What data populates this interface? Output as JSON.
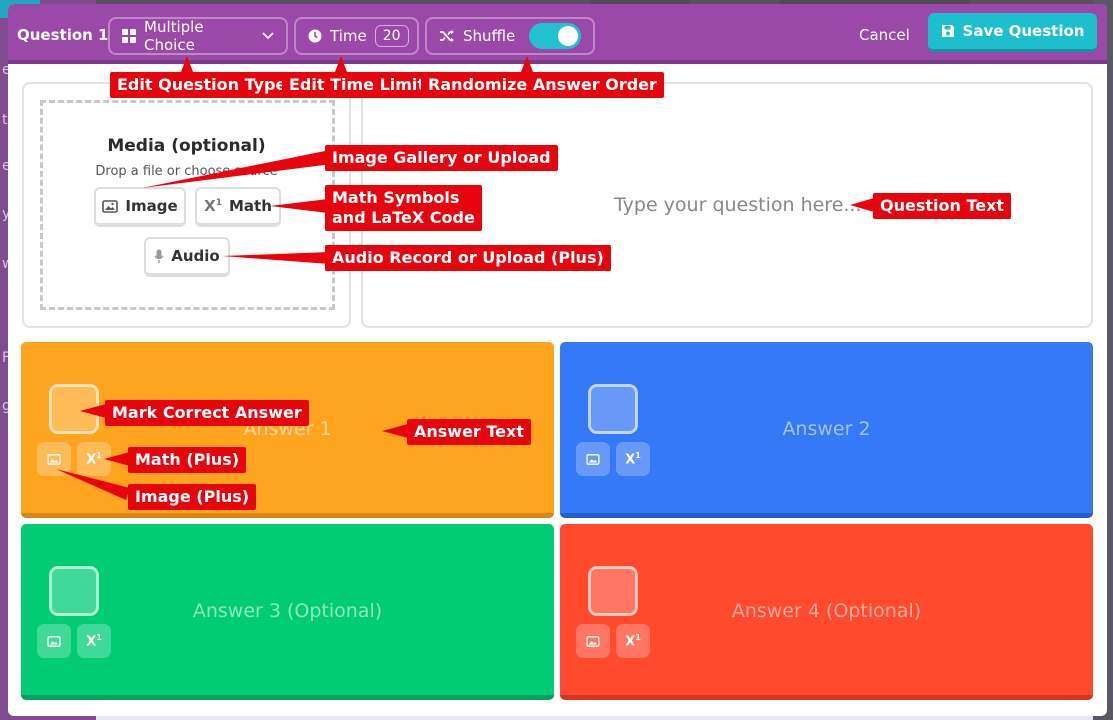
{
  "toolbar": {
    "question_label": "Question 1",
    "type_label": "Multiple Choice",
    "time_label": "Time",
    "time_value": "20",
    "shuffle_label": "Shuffle",
    "shuffle_on": true,
    "cancel_label": "Cancel",
    "save_label": "Save Question"
  },
  "media": {
    "title": "Media (optional)",
    "subtitle": "Drop a file or choose source",
    "image_label": "Image",
    "math_label": "Math",
    "audio_label": "Audio"
  },
  "question": {
    "placeholder": "Type your question here..."
  },
  "answers": [
    {
      "label": "Answer 1",
      "color": "#ffa41f"
    },
    {
      "label": "Answer 2",
      "color": "#3579f6"
    },
    {
      "label": "Answer 3 (Optional)",
      "color": "#00cc74"
    },
    {
      "label": "Answer 4 (Optional)",
      "color": "#ff4a2e"
    }
  ],
  "annotations": {
    "edit_type": "Edit Question Type",
    "edit_time": "Edit Time Limit",
    "randomize": "Randomize Answer Order",
    "image_gallery": "Image Gallery or Upload",
    "math_symbols_1": "Math Symbols",
    "math_symbols_2": "and LaTeX Code",
    "audio": "Audio Record or Upload (Plus)",
    "question_text": "Question Text",
    "mark_correct": "Mark Correct Answer",
    "answer_text": "Answer Text",
    "math_plus": "Math (Plus)",
    "image_plus": "Image (Plus)"
  },
  "background_letters": [
    "e",
    "ts",
    "e",
    "y",
    "w",
    "F",
    "g"
  ],
  "colors": {
    "toolbar": "#9b49a8",
    "save": "#1dbfcf",
    "annotation": "#e8040d"
  }
}
